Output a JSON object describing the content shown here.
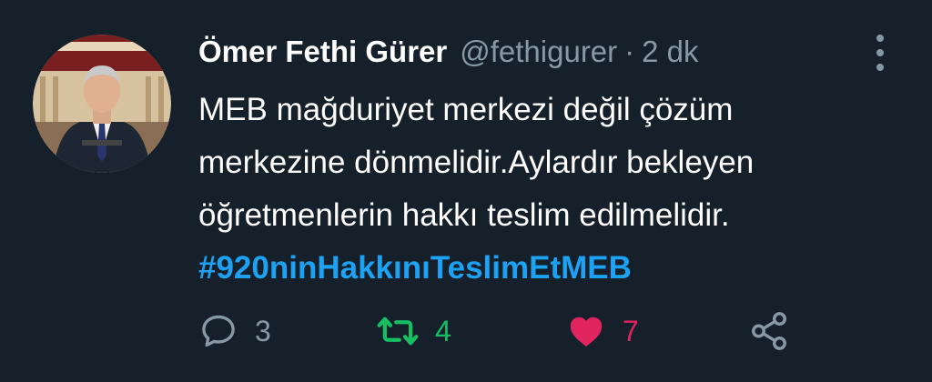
{
  "tweet": {
    "author": {
      "name": "Ömer Fethi Gürer",
      "handle": "@fethigurer",
      "avatar_icon": "profile-photo"
    },
    "separator": "·",
    "timestamp": "2 dk",
    "text_lines": [
      "MEB mağduriyet merkezi değil çözüm",
      "merkezine dönmelidir.Aylardır bekleyen",
      "öğretmenlerin hakkı teslim edilmelidir."
    ],
    "hashtag": "#920ninHakkınıTeslimEtMEB",
    "stats": {
      "replies": "3",
      "retweets": "4",
      "likes": "7"
    },
    "icons": {
      "reply": "reply-icon",
      "retweet": "retweet-icon",
      "like": "heart-icon",
      "share": "share-icon",
      "more": "more-vertical-icon"
    },
    "colors": {
      "background": "#15202b",
      "secondary_text": "#8899a6",
      "link": "#1da1f2",
      "retweet": "#17bf63",
      "like": "#e0245e"
    }
  }
}
